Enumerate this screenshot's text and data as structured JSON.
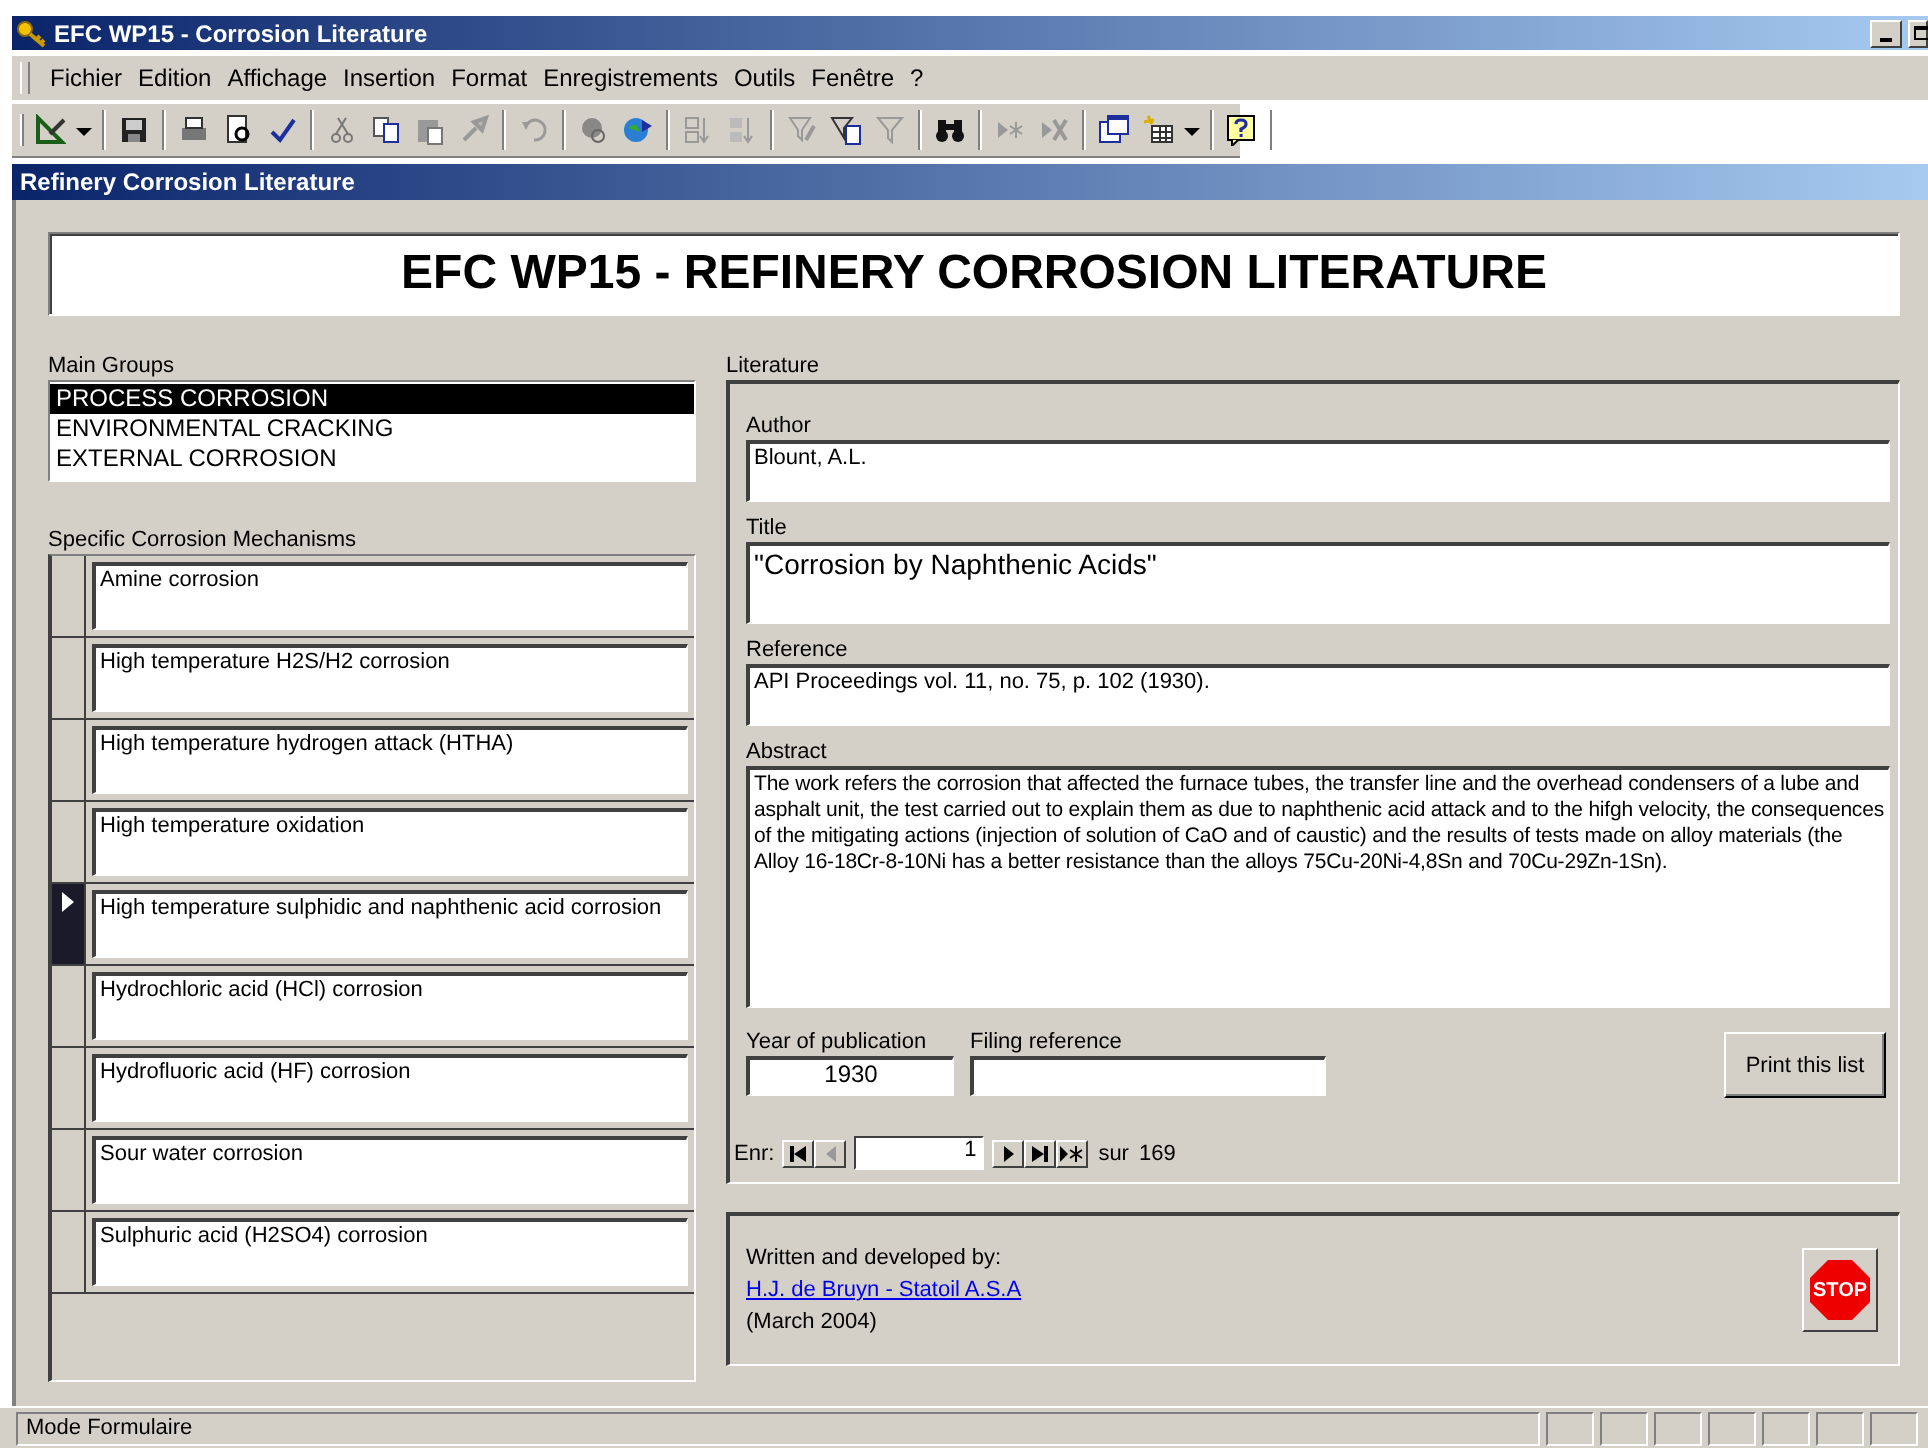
{
  "window": {
    "title": "EFC WP15 - Corrosion Literature"
  },
  "menu": [
    "Fichier",
    "Edition",
    "Affichage",
    "Insertion",
    "Format",
    "Enregistrements",
    "Outils",
    "Fenêtre",
    "?"
  ],
  "form": {
    "caption": "Refinery Corrosion Literature",
    "heading": "EFC WP15 - REFINERY CORROSION LITERATURE"
  },
  "main_groups": {
    "label": "Main Groups",
    "items": [
      {
        "label": "PROCESS CORROSION",
        "selected": true
      },
      {
        "label": "ENVIRONMENTAL CRACKING",
        "selected": false
      },
      {
        "label": "EXTERNAL CORROSION",
        "selected": false
      }
    ]
  },
  "mechanisms": {
    "label": "Specific Corrosion Mechanisms",
    "rows": [
      {
        "text": "Amine corrosion",
        "selected": false
      },
      {
        "text": "High temperature H2S/H2 corrosion",
        "selected": false
      },
      {
        "text": "High temperature hydrogen attack (HTHA)",
        "selected": false
      },
      {
        "text": "High temperature oxidation",
        "selected": false
      },
      {
        "text": "High temperature sulphidic and naphthenic acid corrosion",
        "selected": true
      },
      {
        "text": "Hydrochloric acid (HCl) corrosion",
        "selected": false
      },
      {
        "text": "Hydrofluoric acid (HF) corrosion",
        "selected": false
      },
      {
        "text": "Sour water corrosion",
        "selected": false
      },
      {
        "text": "Sulphuric acid (H2SO4) corrosion",
        "selected": false
      }
    ]
  },
  "literature": {
    "label": "Literature",
    "fields": [
      {
        "kind": "short",
        "label": "Author",
        "value": "Blount, A.L."
      },
      {
        "kind": "title",
        "label": "Title",
        "value": "\"Corrosion by Naphthenic Acids\""
      },
      {
        "kind": "short",
        "label": "Reference",
        "value": "API Proceedings vol. 11, no. 75, p. 102 (1930)."
      },
      {
        "kind": "memo",
        "label": "Abstract",
        "value": "The work refers the corrosion that affected the furnace tubes,  the transfer line and  the overhead condensers of a lube and asphalt unit, the test carried out to explain them as due to naphthenic acid attack and to the hifgh velocity, the consequences of the mitigating actions (injection of solution of CaO and of caustic) and the results of tests made on alloy materials (the Alloy 16-18Cr-8-10Ni has a better resistance than the alloys  75Cu-20Ni-4,8Sn and 70Cu-29Zn-1Sn)."
      }
    ],
    "year": {
      "label": "Year of publication",
      "value": "1930"
    },
    "filing": {
      "label": "Filing reference"
    },
    "print_button": "Print this list",
    "navigator": {
      "label": "Enr:",
      "value": "1",
      "of": "sur",
      "total": "169"
    }
  },
  "credits": {
    "intro": "Written and developed by:",
    "link": "H.J. de Bruyn - Statoil A.S.A",
    "date": "(March 2004)"
  },
  "stop_button": "STOP",
  "status_bar": {
    "text": "Mode Formulaire"
  }
}
